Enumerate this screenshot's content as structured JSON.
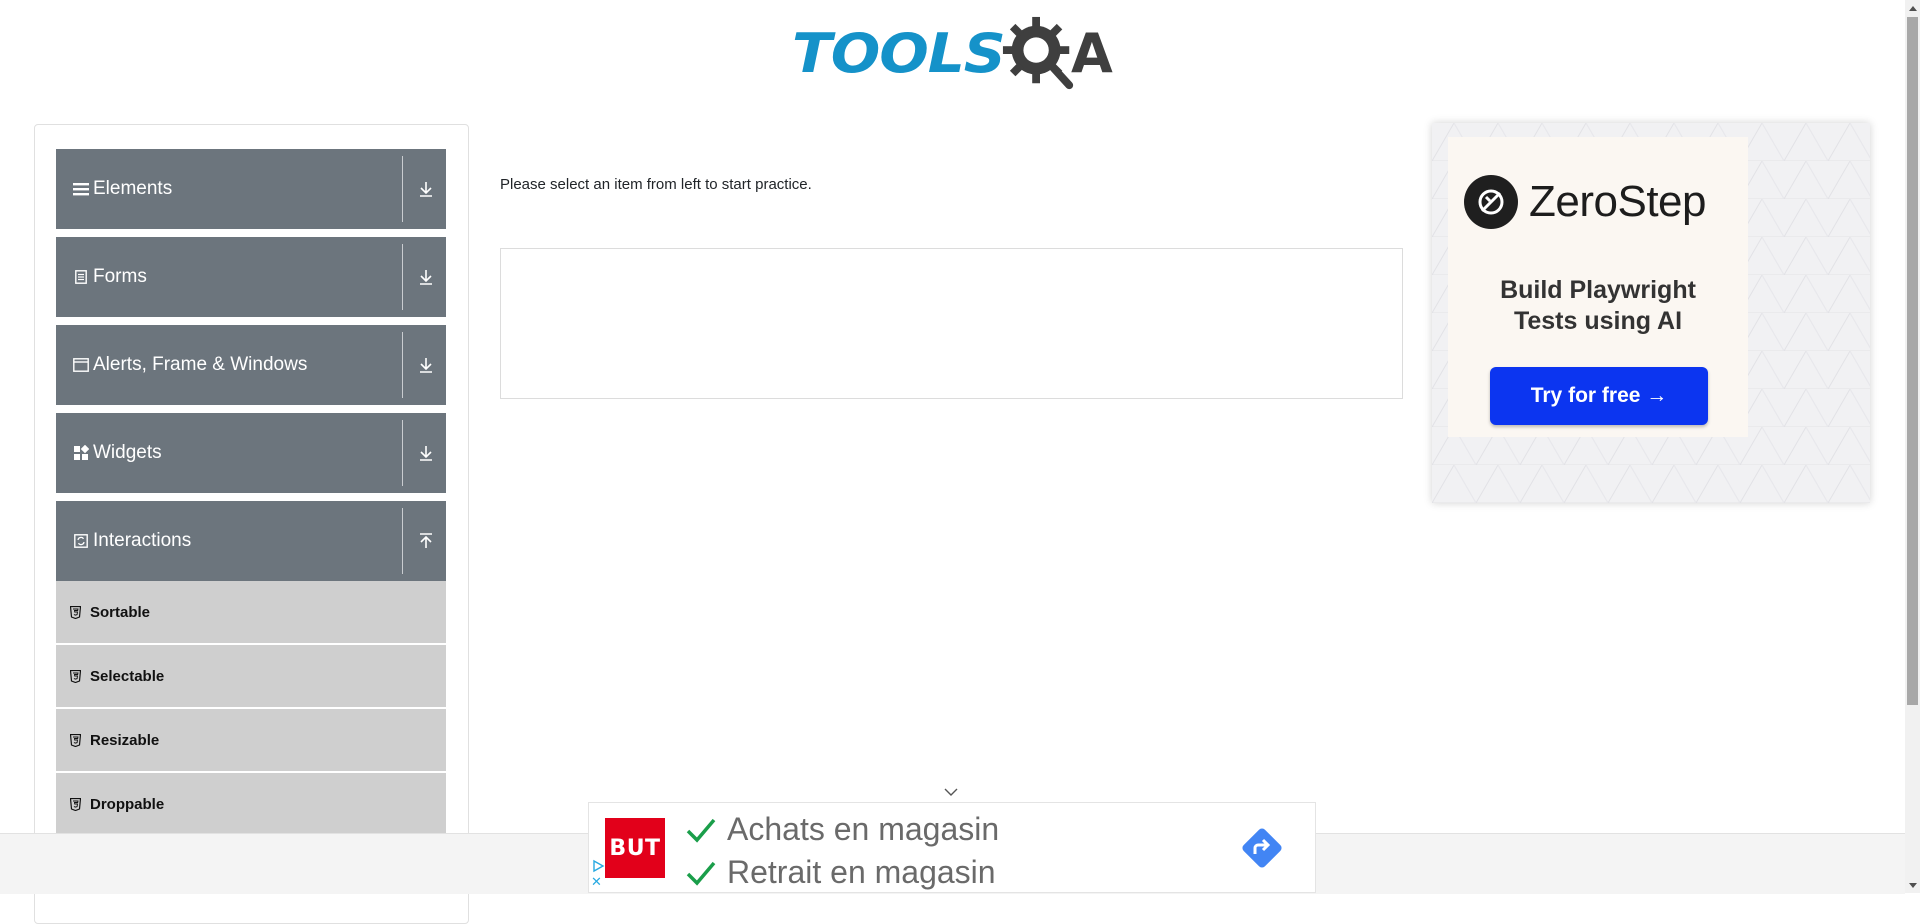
{
  "header": {
    "logo_text_left": "TOOLS",
    "logo_text_right": "A",
    "logo_color_primary": "#1592c9",
    "logo_color_dark": "#3f3f3f"
  },
  "sidebar": {
    "groups": [
      {
        "label": "Elements",
        "icon": "hamburger-icon",
        "state": "collapsed"
      },
      {
        "label": "Forms",
        "icon": "document-icon",
        "state": "collapsed"
      },
      {
        "label": "Alerts, Frame & Windows",
        "icon": "window-icon",
        "state": "collapsed"
      },
      {
        "label": "Widgets",
        "icon": "widgets-icon",
        "state": "collapsed"
      },
      {
        "label": "Interactions",
        "icon": "interactions-icon",
        "state": "expanded"
      }
    ],
    "items": [
      {
        "label": "Sortable",
        "icon": "html5-icon"
      },
      {
        "label": "Selectable",
        "icon": "html5-icon"
      },
      {
        "label": "Resizable",
        "icon": "html5-icon"
      },
      {
        "label": "Droppable",
        "icon": "html5-icon"
      }
    ],
    "header_color": "#6c757d",
    "item_color": "#cfcfcf"
  },
  "main": {
    "instruction": "Please select an item from left to start practice."
  },
  "side_ad": {
    "brand": "ZeroStep",
    "tagline_line1": "Build Playwright",
    "tagline_line2": "Tests using AI",
    "button_label": "Try for free →",
    "button_color": "#0c35f0"
  },
  "bottom_ad": {
    "logo_text": "BUT",
    "line1": "Achats en magasin",
    "line2": "Retrait en magasin",
    "close_label": "✕",
    "brand_color": "#e2001a",
    "check_color": "#1a9e4a",
    "direction_color": "#4285f4"
  }
}
